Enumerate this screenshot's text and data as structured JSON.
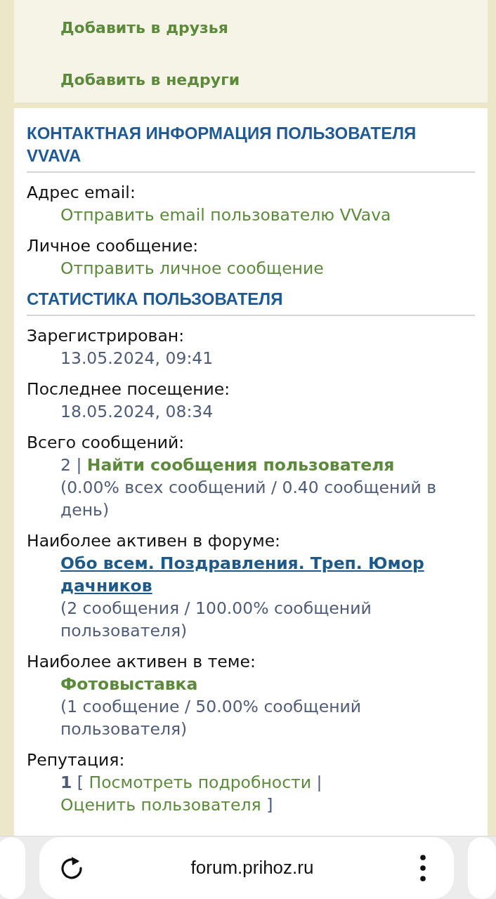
{
  "actions": [
    {
      "label": "Добавить в друзья"
    },
    {
      "label": "Добавить в недруги"
    }
  ],
  "sections": [
    {
      "title": "КОНТАКТНАЯ ИНФОРМАЦИЯ ПОЛЬЗОВАТЕЛЯ VVAVA",
      "fields": [
        {
          "label": "Адрес email:",
          "lines": [
            [
              {
                "kind": "link",
                "text": "Отправить email пользователю VVava"
              }
            ]
          ]
        },
        {
          "label": "Личное сообщение:",
          "lines": [
            [
              {
                "kind": "link",
                "text": "Отправить личное сообщение"
              }
            ]
          ]
        }
      ]
    },
    {
      "title": "СТАТИСТИКА ПОЛЬЗОВАТЕЛЯ",
      "fields": [
        {
          "label": "Зарегистрирован:",
          "lines": [
            [
              {
                "kind": "text",
                "text": "13.05.2024, 09:41"
              }
            ]
          ]
        },
        {
          "label": "Последнее посещение:",
          "lines": [
            [
              {
                "kind": "text",
                "text": "18.05.2024, 08:34"
              }
            ]
          ]
        },
        {
          "label": "Всего сообщений:",
          "lines": [
            [
              {
                "kind": "text",
                "text": "2 |"
              },
              {
                "kind": "bold_link",
                "text": "Найти сообщения пользователя"
              }
            ],
            [
              {
                "kind": "text",
                "text": "(0.00% всех сообщений / 0.40 сообщений в день)"
              }
            ]
          ]
        },
        {
          "label": "Наиболее активен в форуме:",
          "lines": [
            [
              {
                "kind": "forum_link",
                "text": "Обо всем. Поздравления. Треп. Юмор дачников"
              }
            ],
            [
              {
                "kind": "text",
                "text": "(2 сообщения / 100.00% сообщений пользователя)"
              }
            ]
          ]
        },
        {
          "label": "Наиболее активен в теме:",
          "lines": [
            [
              {
                "kind": "bold_link",
                "text": "Фотовыставка"
              }
            ],
            [
              {
                "kind": "text",
                "text": "(1 сообщение / 50.00% сообщений пользователя)"
              }
            ]
          ]
        },
        {
          "label": "Репутация:",
          "lines": [
            [
              {
                "kind": "bold_text",
                "text": "1"
              },
              {
                "kind": "text",
                "text": "["
              },
              {
                "kind": "link",
                "text": "Посмотреть подробности"
              },
              {
                "kind": "text",
                "text": "|"
              },
              {
                "kind": "link",
                "text": "Оценить пользователя"
              },
              {
                "kind": "text",
                "text": "]"
              }
            ]
          ]
        }
      ]
    }
  ],
  "browser": {
    "url": "forum.prihoz.ru"
  }
}
